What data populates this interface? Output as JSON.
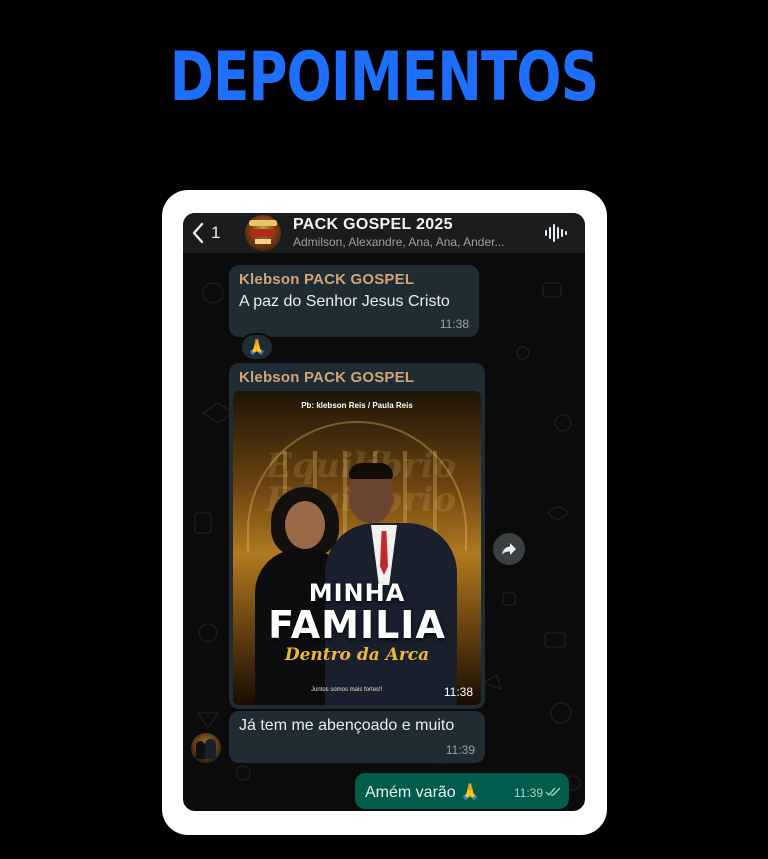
{
  "heading": "DEPOIMENTOS",
  "chat": {
    "back_count": "1",
    "group_name": "PACK GOSPEL 2025",
    "members": "Admilson, Alexandre, Ana, Ana, Ander...",
    "icons": {
      "back": "chevron-left-icon",
      "voice": "audio-wave-icon",
      "forward": "forward-icon"
    }
  },
  "messages": [
    {
      "sender": "Klebson PACK GOSPEL",
      "text": "A paz do Senhor Jesus Cristo",
      "time": "11:38",
      "reaction": "🙏"
    },
    {
      "sender": "Klebson PACK GOSPEL",
      "time": "11:38",
      "flyer": {
        "credit": "Pb: klebson Reis / Paula Reis",
        "title_line1": "MINHA",
        "title_line2": "FAMILIA",
        "title_line3": "Dentro da Arca",
        "footer": "Juntos somos mais fortes!!"
      }
    },
    {
      "text": "Já tem me abençoado e muito",
      "time": "11:39"
    }
  ],
  "outgoing": {
    "text": "Amém varão 🙏",
    "time": "11:39",
    "status": "read"
  },
  "colors": {
    "heading": "#1f6fff",
    "incoming_bubble": "#1f2c33",
    "outgoing_bubble": "#005c4b",
    "sender_name": "#d4a373"
  }
}
